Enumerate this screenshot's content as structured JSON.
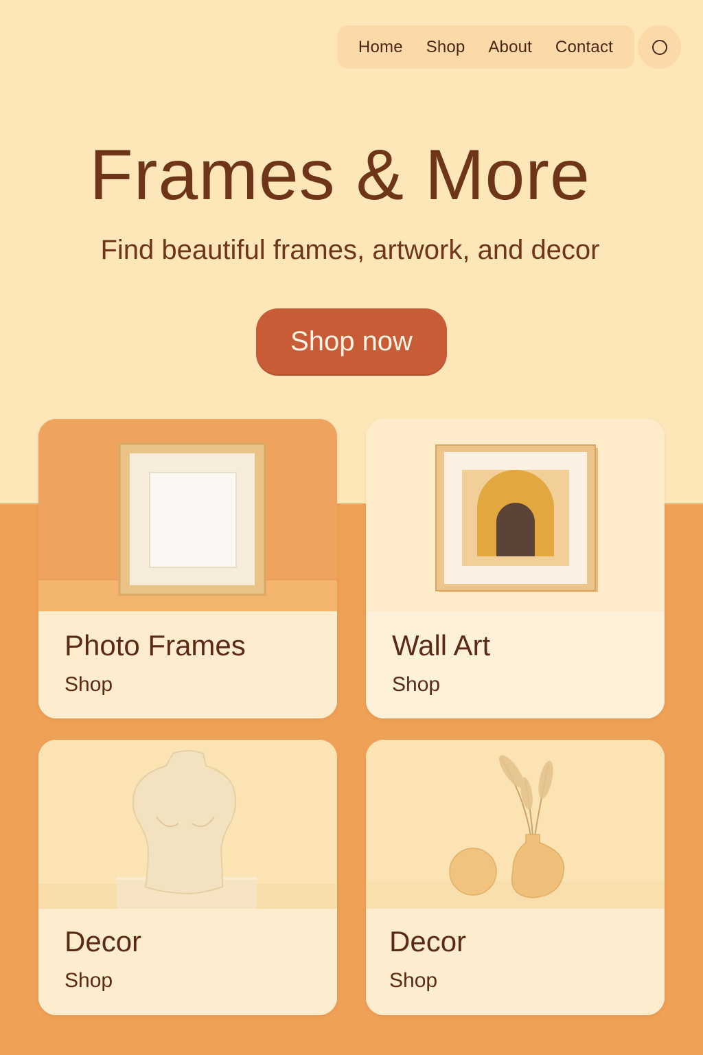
{
  "nav": {
    "items": [
      {
        "label": "Home"
      },
      {
        "label": "Shop"
      },
      {
        "label": "About"
      },
      {
        "label": "Contact"
      }
    ],
    "search_icon": "circle-icon"
  },
  "hero": {
    "title": "Frames & More",
    "subtitle": "Find beautiful frames, artwork, and decor",
    "cta_label": "Shop now"
  },
  "categories": [
    {
      "title": "Photo Frames",
      "link": "Shop",
      "image": "empty-wooden-frame"
    },
    {
      "title": "Wall Art",
      "link": "Shop",
      "image": "framed-arch-artwork"
    },
    {
      "title": "Decor",
      "link": "Shop",
      "image": "mannequin-bust"
    },
    {
      "title": "Decor",
      "link": "Shop",
      "image": "vase-with-pampas-and-sphere"
    }
  ],
  "colors": {
    "background_top": "#fde7b8",
    "background_bottom": "#efa257",
    "accent": "#c85c36",
    "text": "#6e3518",
    "card": "#fdeccd"
  }
}
